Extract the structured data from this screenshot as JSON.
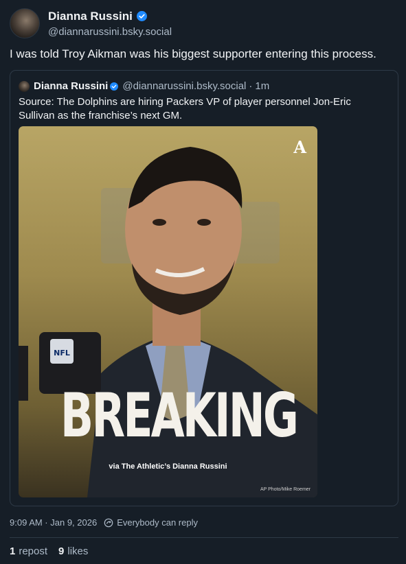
{
  "author": {
    "display_name": "Dianna Russini",
    "handle": "@diannarussini.bsky.social"
  },
  "post": {
    "text": "I was told Troy Aikman was his biggest supporter entering this process."
  },
  "quote": {
    "display_name": "Dianna Russini",
    "handle": "@diannarussini.bsky.social",
    "separator": "·",
    "time": "1m",
    "text": "Source: The Dolphins are hiring Packers VP of player personnel Jon-Eric Sullivan as the franchise’s next GM.",
    "media": {
      "logo": "A",
      "headline": "BREAKING",
      "byline": "via The Athletic’s Dianna Russini",
      "credit": "AP Photo/Mike Roemer",
      "mic_brand": "NFL"
    }
  },
  "meta": {
    "timestamp": "9:09 AM · Jan 9, 2026",
    "reply_setting": "Everybody can reply",
    "reply_icon": "reply-settings-icon"
  },
  "stats": {
    "reposts_count": "1",
    "reposts_label": "repost",
    "likes_count": "9",
    "likes_label": "likes"
  },
  "colors": {
    "background": "#161e27",
    "verified": "#208bfe",
    "muted_text": "#aebbc9",
    "border": "#2e3a47"
  }
}
